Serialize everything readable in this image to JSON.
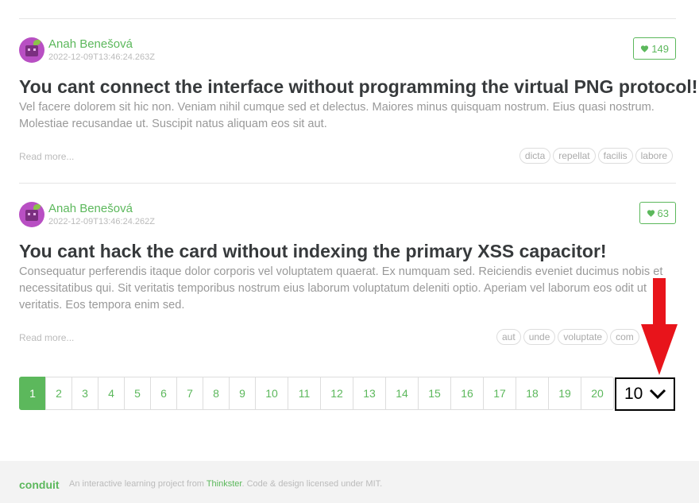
{
  "articles": [
    {
      "author": "Anah Benešová",
      "date": "2022-12-09T13:46:24.263Z",
      "likes": "149",
      "title": "You cant connect the interface without programming the virtual PNG protocol!",
      "description": "Vel facere dolorem sit hic non. Veniam nihil cumque sed et delectus. Maiores minus quisquam nostrum. Eius quasi nostrum. Molestiae recusandae ut. Suscipit natus aliquam eos sit aut.",
      "read_more": "Read more...",
      "tags": [
        "dicta",
        "repellat",
        "facilis",
        "labore"
      ]
    },
    {
      "author": "Anah Benešová",
      "date": "2022-12-09T13:46:24.262Z",
      "likes": "63",
      "title": "You cant hack the card without indexing the primary XSS capacitor!",
      "description": "Consequatur perferendis itaque dolor corporis vel voluptatem quaerat. Ex numquam sed. Reiciendis eveniet ducimus nobis et necessitatibus qui. Sit veritatis temporibus nostrum eius laborum voluptatum deleniti optio. Aperiam vel laborum eos odit ut veritatis. Eos tempora enim sed.",
      "read_more": "Read more...",
      "tags": [
        "aut",
        "unde",
        "voluptate",
        "com"
      ]
    }
  ],
  "pagination": {
    "pages": [
      "1",
      "2",
      "3",
      "4",
      "5",
      "6",
      "7",
      "8",
      "9",
      "10",
      "11",
      "12",
      "13",
      "14",
      "15",
      "16",
      "17",
      "18",
      "19",
      "20"
    ],
    "active": "1"
  },
  "overlay": {
    "value": "10",
    "arrow_color": "#e8141b"
  },
  "footer": {
    "logo": "conduit",
    "text_before": "An interactive learning project from ",
    "link": "Thinkster",
    "text_after": ". Code & design licensed under MIT."
  },
  "colors": {
    "brand": "#5cb85c"
  }
}
